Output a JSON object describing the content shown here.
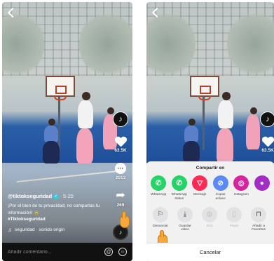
{
  "left_screen": {
    "caption": {
      "username": "@tiktokseguridad",
      "date": "· 5-25",
      "verified_mark": "✓",
      "text": "¡Por el bien de tu privacidad, no compartas tu información! 🔒",
      "hashtag": "#Tiktokseguridad",
      "music": "seguridad · sonido origin"
    },
    "rail": {
      "avatar_glyph": "♪",
      "likes": "63.5K",
      "comments": "2013",
      "shares": "269"
    },
    "comment_bar": {
      "placeholder": "Añadir comentario...",
      "at_icon": "@",
      "emoji_icon": "☺"
    }
  },
  "right_screen": {
    "rail": {
      "avatar_glyph": "♪",
      "likes": "63.5K"
    },
    "share_sheet": {
      "title": "Compartir en",
      "share_options": [
        {
          "label": "WhatsApp",
          "icon": "whatsapp-icon",
          "color": "#25d366",
          "glyph": "✆"
        },
        {
          "label": "WhatsApp status",
          "icon": "whatsapp-status-icon",
          "color": "#25d366",
          "glyph": "✆"
        },
        {
          "label": "Mensaje",
          "icon": "message-icon",
          "color": "#fe2c55",
          "glyph": "▽"
        },
        {
          "label": "Copiar enlace",
          "icon": "link-icon",
          "color": "#5b8af7",
          "glyph": "⊘"
        },
        {
          "label": "Instagram",
          "icon": "instagram-icon",
          "color": "#d6249f",
          "glyph": "◎"
        },
        {
          "label": "",
          "icon": "more-share-icon",
          "color": "#a32cc4",
          "glyph": "●"
        }
      ],
      "action_options": [
        {
          "label": "Denunciar",
          "icon": "flag-icon",
          "glyph": "⚐",
          "disabled": false
        },
        {
          "label": "Guardar video",
          "icon": "download-icon",
          "glyph": "⤓",
          "disabled": false
        },
        {
          "label": "Dúo",
          "icon": "duet-icon",
          "glyph": "◍",
          "disabled": true
        },
        {
          "label": "Pegar",
          "icon": "sticker-icon",
          "glyph": "▯",
          "disabled": true
        },
        {
          "label": "Añadir a Favoritos",
          "icon": "bookmark-icon",
          "glyph": "⊓",
          "disabled": false
        }
      ],
      "cancel_label": "Cancelar"
    }
  }
}
